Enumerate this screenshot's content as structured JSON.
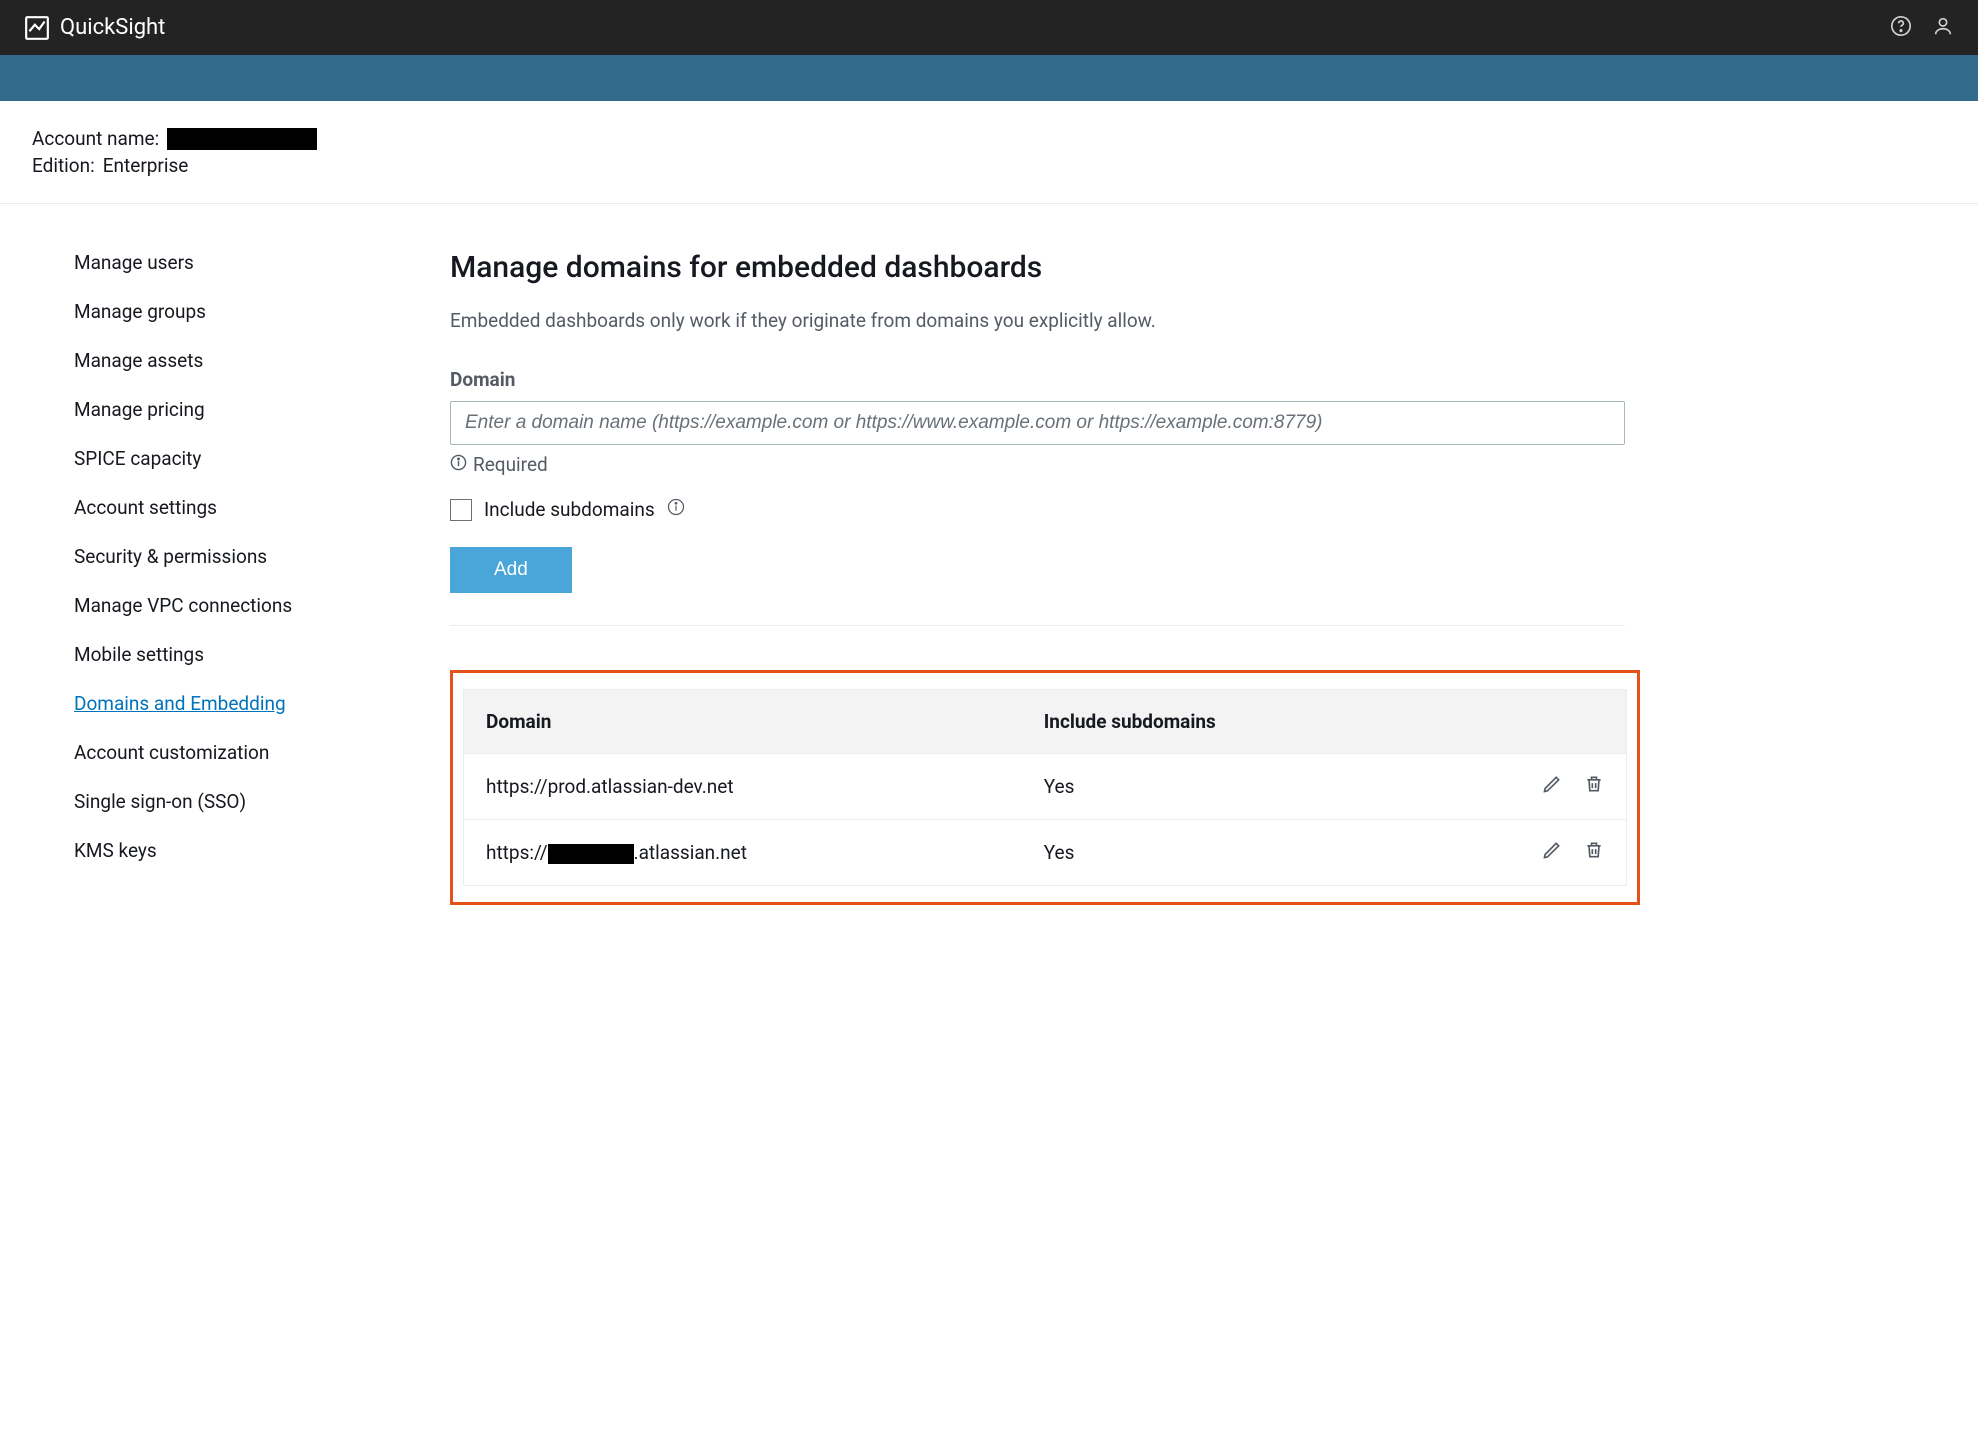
{
  "header": {
    "brand": "QuickSight"
  },
  "account": {
    "name_label": "Account name:",
    "edition_label": "Edition:",
    "edition_value": "Enterprise"
  },
  "sidebar": {
    "items": [
      {
        "label": "Manage users",
        "active": false
      },
      {
        "label": "Manage groups",
        "active": false
      },
      {
        "label": "Manage assets",
        "active": false
      },
      {
        "label": "Manage pricing",
        "active": false
      },
      {
        "label": "SPICE capacity",
        "active": false
      },
      {
        "label": "Account settings",
        "active": false
      },
      {
        "label": "Security & permissions",
        "active": false
      },
      {
        "label": "Manage VPC connections",
        "active": false
      },
      {
        "label": "Mobile settings",
        "active": false
      },
      {
        "label": "Domains and Embedding",
        "active": true
      },
      {
        "label": "Account customization",
        "active": false
      },
      {
        "label": "Single sign-on (SSO)",
        "active": false
      },
      {
        "label": "KMS keys",
        "active": false
      }
    ]
  },
  "main": {
    "title": "Manage domains for embedded dashboards",
    "description": "Embedded dashboards only work if they originate from domains you explicitly allow.",
    "domain_label": "Domain",
    "domain_placeholder": "Enter a domain name (https://example.com or https://www.example.com or https://example.com:8779)",
    "required_text": "Required",
    "include_sub_label": "Include subdomains",
    "add_button": "Add",
    "table": {
      "col_domain": "Domain",
      "col_subdomains": "Include subdomains",
      "rows": [
        {
          "domain_prefix": "https://prod.atlassian-dev.net",
          "domain_redacted": false,
          "domain_suffix": "",
          "include_sub": "Yes"
        },
        {
          "domain_prefix": "https://",
          "domain_redacted": true,
          "domain_suffix": ".atlassian.net",
          "include_sub": "Yes"
        }
      ]
    }
  }
}
